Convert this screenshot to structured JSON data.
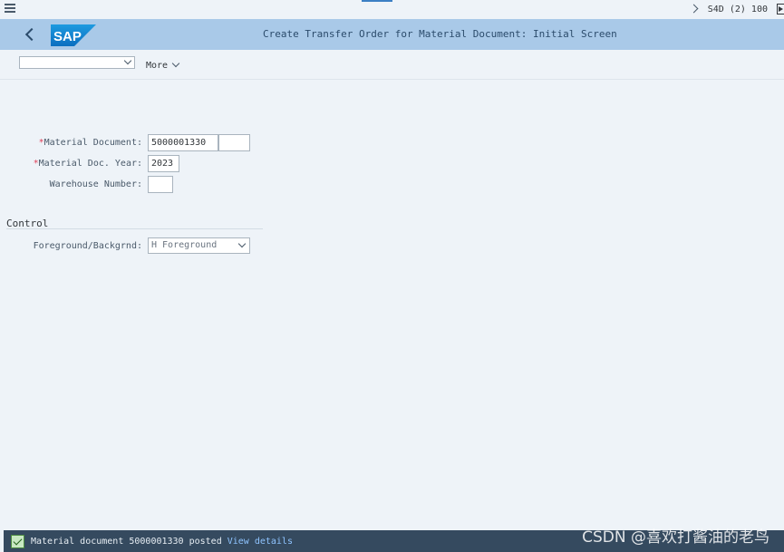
{
  "topbar": {
    "menu_icon": "hamburger-menu-icon",
    "system_info": "S4D (2) 100"
  },
  "shellbar": {
    "logo_text": "SAP",
    "title": "Create Transfer Order for Material Document: Initial Screen"
  },
  "toolbar": {
    "select_value": "",
    "more_label": "More"
  },
  "form": {
    "material_document": {
      "label": "Material Document:",
      "value": "5000001330",
      "item_value": "",
      "required": true
    },
    "material_doc_year": {
      "label": "Material Doc. Year:",
      "value": "2023",
      "required": true
    },
    "warehouse_number": {
      "label": "Warehouse Number:",
      "value": ""
    }
  },
  "control": {
    "section_title": "Control",
    "fg_bg_label": "Foreground/Backgrnd:",
    "fg_bg_value": "H Foreground"
  },
  "statusbar": {
    "message": "Material document 5000001330 posted",
    "link": "View details",
    "status_icon": "success-check-icon"
  },
  "watermark": "CSDN @喜欢打酱油的老鸟",
  "colors": {
    "shellbar_bg": "#a9c9e8",
    "page_bg": "#eef3f8",
    "statusbar_bg": "#354a5f",
    "required_marker": "#e0415a",
    "link": "#8fc4ff"
  }
}
